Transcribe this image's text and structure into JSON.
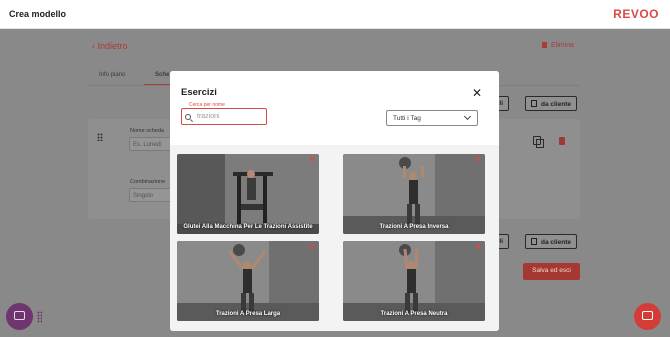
{
  "topbar": {
    "title": "Crea modello",
    "logo": "REVOO"
  },
  "page": {
    "back_label": "Indietro",
    "delete_label": "Elimina",
    "tabs": [
      {
        "label": "Info piano"
      },
      {
        "label": "Sche"
      }
    ],
    "card": {
      "name_label": "Nome scheda",
      "name_placeholder": "Es. Lunedì",
      "combo_label": "Combinazione",
      "combo_value": "Singolo"
    },
    "buttons": {
      "template_partial_top": "delli",
      "from_client_top": "da cliente",
      "template_partial_bottom": "delli",
      "from_client_bottom": "da cliente",
      "save_exit": "Salva ed esci"
    }
  },
  "modal": {
    "title": "Esercizi",
    "search": {
      "floating_label": "Cerca per nome",
      "value": "trazioni"
    },
    "tag_filter": {
      "selected": "Tutti i Tag"
    },
    "exercises": [
      {
        "name": "Glutei Alla Macchina Per Le Trazioni Assistite",
        "brand": "R"
      },
      {
        "name": "Trazioni A Presa Inversa",
        "brand": "R"
      },
      {
        "name": "Trazioni A Presa Larga",
        "brand": "R"
      },
      {
        "name": "Trazioni A Presa Neutra",
        "brand": "R"
      }
    ]
  },
  "colors": {
    "accent": "#d94a45",
    "overlay": "#898989",
    "chat_fab": "#6e3570"
  },
  "icons": {
    "close": "close-icon",
    "search": "search-icon",
    "chevron": "chevron-down-icon",
    "chat": "chat-icon"
  }
}
